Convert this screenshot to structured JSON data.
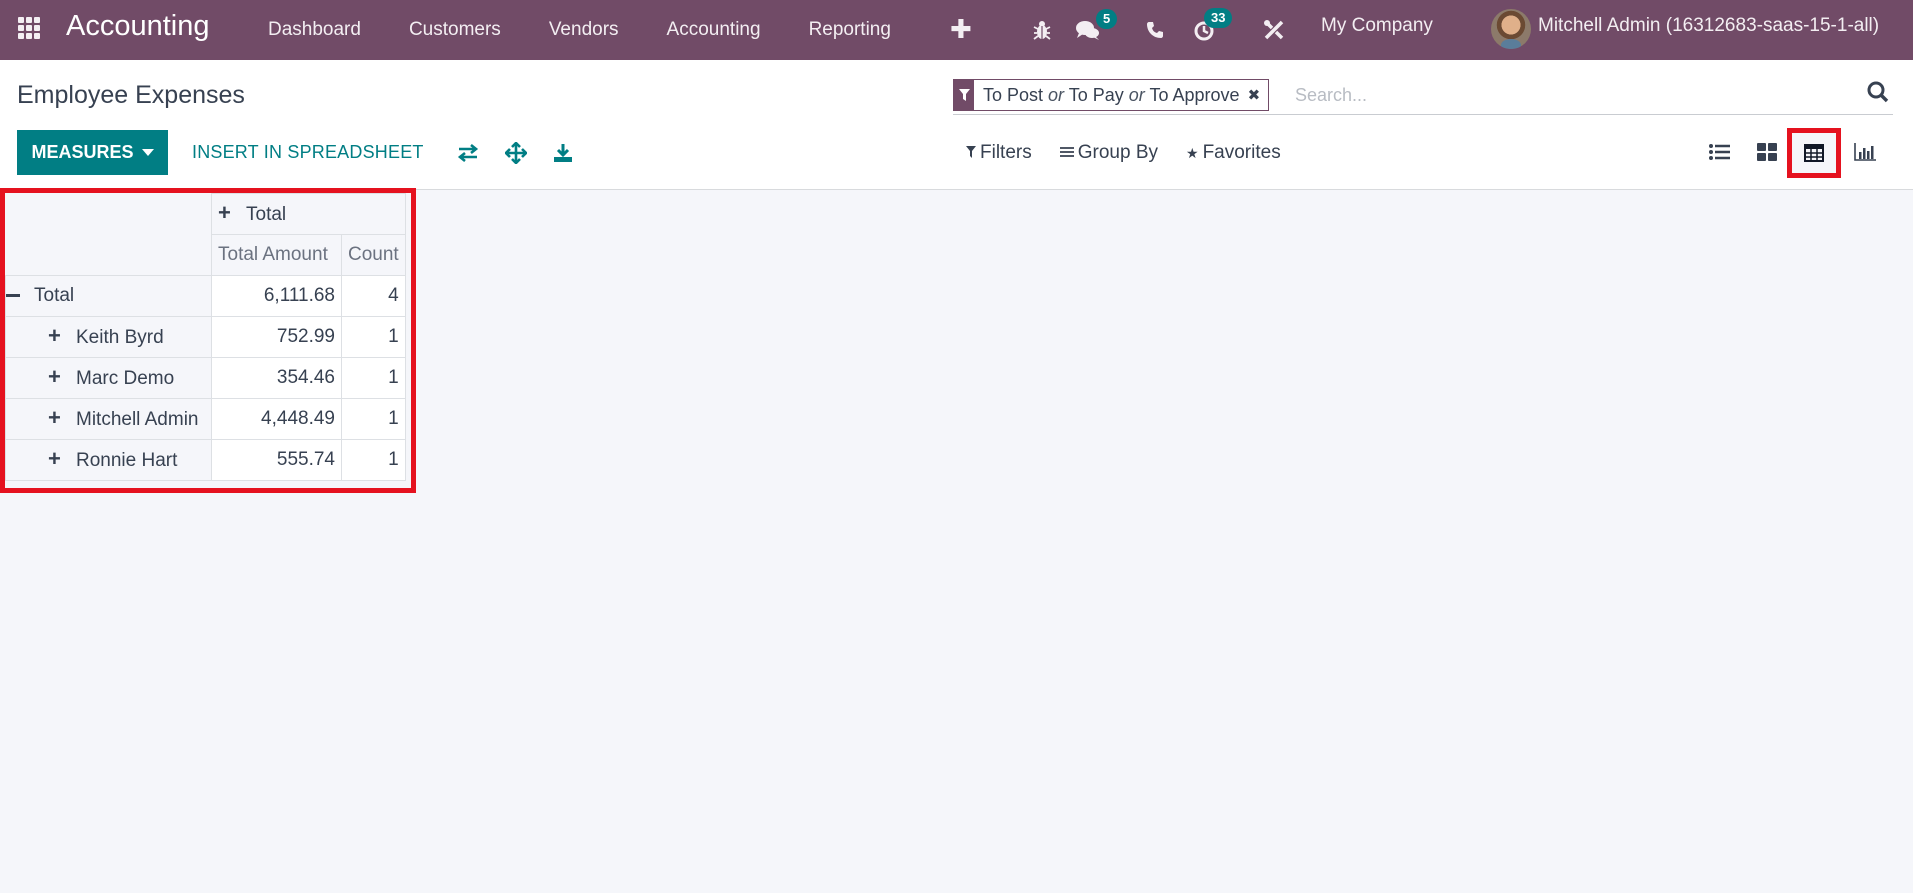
{
  "navbar": {
    "app_name": "Accounting",
    "menu": [
      "Dashboard",
      "Customers",
      "Vendors",
      "Accounting",
      "Reporting"
    ],
    "icons": [
      "apps-icon",
      "plus-icon",
      "bug-icon",
      "chat-icon",
      "phone-icon",
      "activity-clock-icon",
      "tools-icon"
    ],
    "messages_badge": "5",
    "activities_badge": "33",
    "company": "My Company",
    "user": "Mitchell Admin (16312683-saas-15-1-all)",
    "colors": {
      "brand": "#714b67",
      "badge": "#017e84"
    }
  },
  "control_panel": {
    "title": "Employee Expenses",
    "measures_label": "MEASURES",
    "insert_label": "INSERT IN SPREADSHEET",
    "tool_icons": [
      "flip-axis-icon",
      "expand-all-icon",
      "download-icon"
    ],
    "search": {
      "facet_icon": "filter-icon",
      "facet_parts": [
        "To Post",
        "or",
        "To Pay",
        "or",
        "To Approve"
      ],
      "placeholder": "Search..."
    },
    "filters_label": "Filters",
    "groupby_label": "Group By",
    "favorites_label": "Favorites",
    "views": [
      {
        "name": "list-view-icon",
        "active": false
      },
      {
        "name": "kanban-view-icon",
        "active": false
      },
      {
        "name": "pivot-view-icon",
        "active": true
      },
      {
        "name": "graph-view-icon",
        "active": false
      }
    ],
    "accent_color": "#017e84",
    "highlight_color": "#e5121f"
  },
  "pivot": {
    "col_header": "Total",
    "measures": [
      "Total Amount",
      "Count"
    ],
    "total_row": {
      "label": "Total",
      "amount": "6,111.68",
      "count": "4"
    },
    "rows": [
      {
        "label": "Keith Byrd",
        "amount": "752.99",
        "count": "1"
      },
      {
        "label": "Marc Demo",
        "amount": "354.46",
        "count": "1"
      },
      {
        "label": "Mitchell Admin",
        "amount": "4,448.49",
        "count": "1"
      },
      {
        "label": "Ronnie Hart",
        "amount": "555.74",
        "count": "1"
      }
    ]
  }
}
